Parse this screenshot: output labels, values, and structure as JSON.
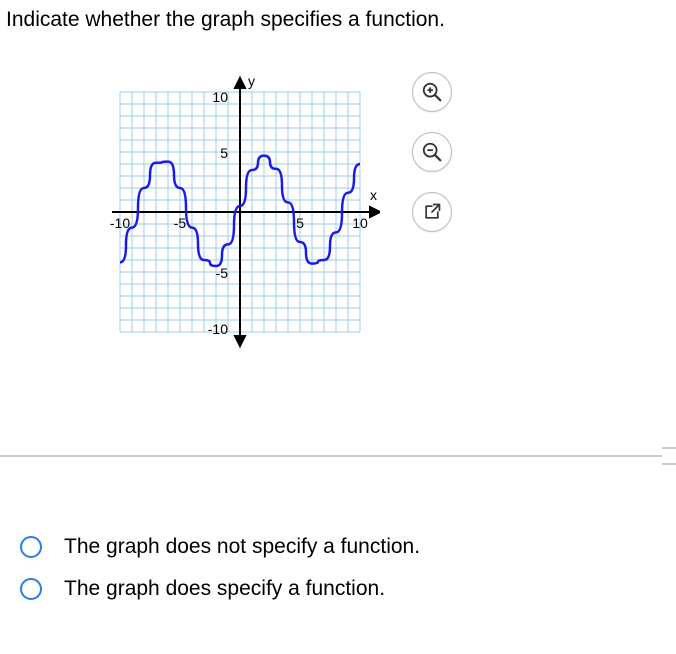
{
  "question": "Indicate whether the graph specifies a function.",
  "chart_data": {
    "type": "line",
    "title": "",
    "xlabel": "x",
    "ylabel": "y",
    "xlim": [
      -10,
      10
    ],
    "ylim": [
      -10,
      10
    ],
    "x_ticks": [
      -10,
      -5,
      5,
      10
    ],
    "y_ticks": [
      -10,
      -5,
      5,
      10
    ],
    "series": [
      {
        "name": "curve",
        "description": "sinusoidal wave",
        "color": "#1a1aee",
        "x": [
          -10,
          -9,
          -8,
          -7,
          -6,
          -5,
          -4,
          -3,
          -2,
          -1,
          0,
          1,
          2,
          3,
          4,
          5,
          6,
          7,
          8,
          9,
          10
        ],
        "y": [
          -4.2,
          -1.3,
          2.0,
          4.1,
          4.2,
          2.0,
          -1.3,
          -4.0,
          -4.5,
          -2.7,
          0.5,
          3.5,
          4.7,
          3.6,
          0.8,
          -2.5,
          -4.3,
          -4.0,
          -1.7,
          1.6,
          4.0
        ]
      }
    ]
  },
  "axis": {
    "y_label": "y",
    "x_label": "x",
    "tick_neg10": "-10",
    "tick_neg5": "-5",
    "tick_5": "5",
    "tick_10": "10",
    "ytick_10": "10",
    "ytick_5": "5",
    "ytick_neg5": "-5",
    "ytick_neg10": "-10"
  },
  "tools": {
    "zoom_in": "zoom-in",
    "zoom_out": "zoom-out",
    "open": "open-external"
  },
  "answers": {
    "opt1": "The graph does not specify a function.",
    "opt2": "The graph does specify a function."
  }
}
